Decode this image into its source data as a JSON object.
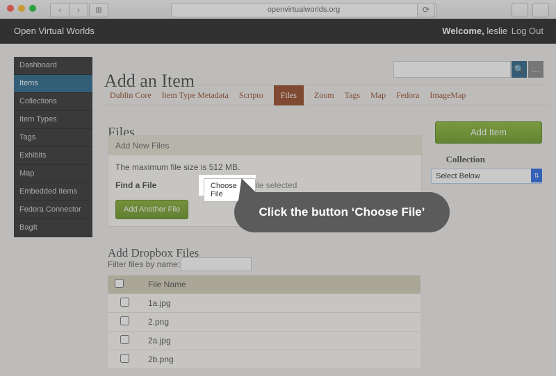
{
  "browser": {
    "url": "openvirtualworlds.org"
  },
  "topnav": {
    "brand": "Open Virtual Worlds",
    "welcome_label": "Welcome,",
    "user": "leslie",
    "logout": "Log Out"
  },
  "sidebar": {
    "items": [
      {
        "label": "Dashboard"
      },
      {
        "label": "Items"
      },
      {
        "label": "Collections"
      },
      {
        "label": "Item Types"
      },
      {
        "label": "Tags"
      },
      {
        "label": "Exhibits"
      },
      {
        "label": "Map"
      },
      {
        "label": "Embedded Items"
      },
      {
        "label": "Fedora Connector"
      },
      {
        "label": "BagIt"
      }
    ],
    "active_index": 1
  },
  "page": {
    "title": "Add an Item"
  },
  "tabs": {
    "items": [
      "Dublin Core",
      "Item Type Metadata",
      "Scripto",
      "Files",
      "Zoom",
      "Tags",
      "Map",
      "Fedora",
      "ImageMap"
    ],
    "active_index": 3
  },
  "files": {
    "heading": "Files",
    "panel_title": "Add New Files",
    "max_size": "The maximum file size is 512 MB.",
    "find_label": "Find a File",
    "choose_label": "Choose File",
    "no_file": "no file selected",
    "add_another": "Add Another File"
  },
  "actions": {
    "add_item": "Add Item"
  },
  "collection": {
    "label": "Collection",
    "selected": "Select Below"
  },
  "dropbox": {
    "heading": "Add Dropbox Files",
    "filter_label": "Filter files by name:",
    "col_header": "File Name",
    "rows": [
      "1a.jpg",
      "2.png",
      "2a.jpg",
      "2b.png"
    ]
  },
  "callout": {
    "text": "Click the button ‘Choose File’"
  }
}
